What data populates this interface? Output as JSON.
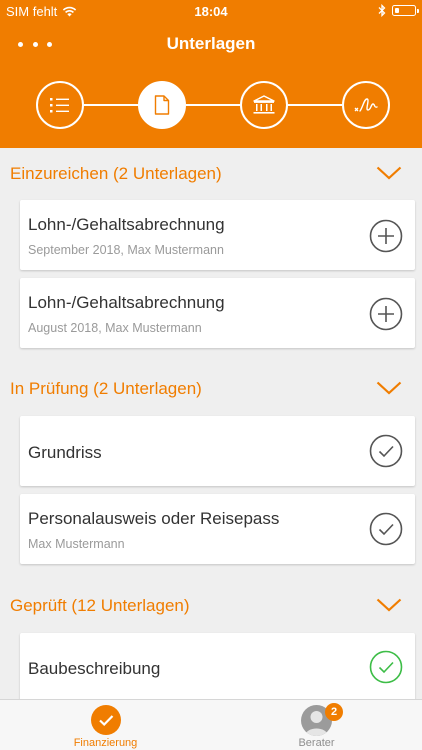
{
  "status": {
    "carrier": "SIM fehlt",
    "time": "18:04",
    "battery_level": 0.2
  },
  "nav": {
    "title": "Unterlagen"
  },
  "stepper": {
    "steps": [
      "list-icon",
      "document-icon",
      "bank-icon",
      "signature-icon"
    ],
    "active_index": 1
  },
  "sections": [
    {
      "title": "Einzureichen (2 Unterlagen)",
      "items": [
        {
          "title": "Lohn-/Gehaltsabrechnung",
          "subtitle": "September 2018, Max Mustermann",
          "action": "add-icon"
        },
        {
          "title": "Lohn-/Gehaltsabrechnung",
          "subtitle": "August 2018, Max Mustermann",
          "action": "add-icon"
        }
      ]
    },
    {
      "title": "In Prüfung (2 Unterlagen)",
      "items": [
        {
          "title": "Grundriss",
          "action": "check-icon"
        },
        {
          "title": "Personalausweis oder Reisepass",
          "subtitle": "Max Mustermann",
          "action": "check-icon"
        }
      ]
    },
    {
      "title": "Geprüft (12 Unterlagen)",
      "items": [
        {
          "title": "Baubeschreibung",
          "action": "check-green-icon"
        }
      ]
    }
  ],
  "colors": {
    "accent": "#f07d00",
    "check_gray": "#555555",
    "check_green": "#3dbd47"
  },
  "tabbar": {
    "tabs": [
      {
        "label": "Finanzierung",
        "icon": "check-circle-icon",
        "active": true
      },
      {
        "label": "Berater",
        "icon": "avatar-icon",
        "badge": "2"
      }
    ]
  }
}
